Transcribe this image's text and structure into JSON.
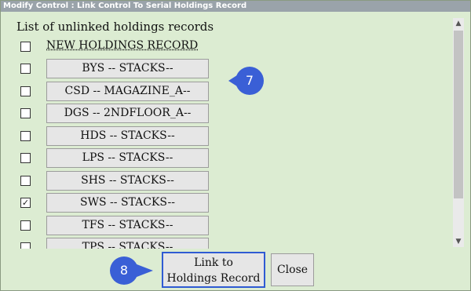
{
  "window": {
    "title": "Modify Control : Link Control To Serial Holdings Record"
  },
  "section_label": "List of unlinked holdings records",
  "new_holdings": {
    "label": "NEW HOLDINGS RECORD",
    "checked": false
  },
  "records": [
    {
      "label": "BYS -- STACKS--",
      "checked": false
    },
    {
      "label": "CSD -- MAGAZINE_A--",
      "checked": false
    },
    {
      "label": "DGS -- 2NDFLOOR_A--",
      "checked": false
    },
    {
      "label": "HDS -- STACKS--",
      "checked": false
    },
    {
      "label": "LPS -- STACKS--",
      "checked": false
    },
    {
      "label": "SHS -- STACKS--",
      "checked": false
    },
    {
      "label": "SWS -- STACKS--",
      "checked": true
    },
    {
      "label": "TFS -- STACKS--",
      "checked": false
    },
    {
      "label": "TPS -- STACKS--",
      "checked": false
    }
  ],
  "callouts": {
    "c7": "7",
    "c8": "8"
  },
  "buttons": {
    "link_line1": "Link to",
    "link_line2": "Holdings Record",
    "close": "Close"
  },
  "icons": {
    "scroll_up": "chevron-up-icon",
    "scroll_down": "chevron-down-icon",
    "check": "checkmark-icon"
  },
  "colors": {
    "window_bg": "#dcecd2",
    "callout": "#3a5fd6",
    "focus_border": "#2f5bd3"
  }
}
